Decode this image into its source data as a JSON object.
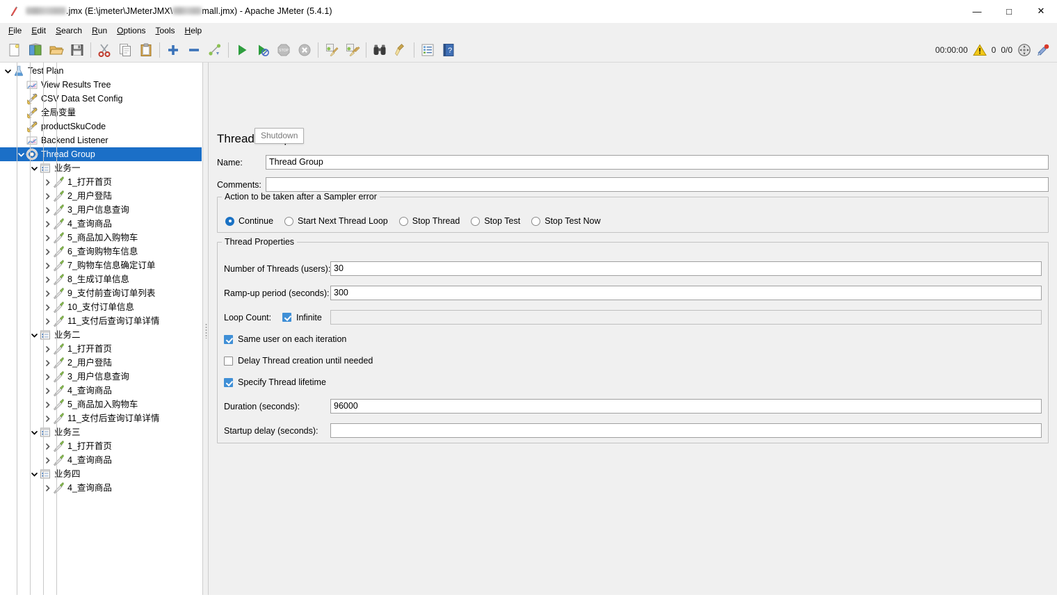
{
  "window": {
    "title_suffix": ".jmx (E:\\jmeter\\JMeterJMX\\",
    "title_mid": "mall.jmx) - Apache JMeter (5.4.1)",
    "app_icon": "jmeter-icon",
    "minimize": "—",
    "maximize": "□",
    "close": "✕"
  },
  "menu": {
    "items": [
      {
        "mnemonic": "F",
        "rest": "ile"
      },
      {
        "mnemonic": "E",
        "rest": "dit"
      },
      {
        "mnemonic": "S",
        "rest": "earch"
      },
      {
        "mnemonic": "R",
        "rest": "un"
      },
      {
        "mnemonic": "O",
        "rest": "ptions"
      },
      {
        "mnemonic": "T",
        "rest": "ools"
      },
      {
        "mnemonic": "H",
        "rest": "elp"
      }
    ]
  },
  "toolbar": {
    "buttons": [
      {
        "name": "new-button",
        "icon": "new-document-icon"
      },
      {
        "name": "templates-button",
        "icon": "templates-icon"
      },
      {
        "name": "open-button",
        "icon": "open-folder-icon"
      },
      {
        "name": "save-button",
        "icon": "save-disk-icon"
      },
      {
        "name": "cut-button",
        "icon": "scissors-icon"
      },
      {
        "name": "copy-button",
        "icon": "copy-icon"
      },
      {
        "name": "paste-button",
        "icon": "clipboard-icon"
      },
      {
        "name": "expand-all-button",
        "icon": "plus-icon"
      },
      {
        "name": "collapse-all-button",
        "icon": "minus-icon"
      },
      {
        "name": "toggle-button",
        "icon": "toggle-icon"
      },
      {
        "name": "start-button",
        "icon": "play-icon"
      },
      {
        "name": "start-no-pauses-button",
        "icon": "play-no-pauses-icon"
      },
      {
        "name": "stop-button",
        "icon": "stop-sign-icon"
      },
      {
        "name": "shutdown-button",
        "icon": "shutdown-icon"
      },
      {
        "name": "clear-button",
        "icon": "clear-broom-icon"
      },
      {
        "name": "clear-all-button",
        "icon": "clear-all-broom-icon"
      },
      {
        "name": "search-button",
        "icon": "binoculars-icon"
      },
      {
        "name": "reset-search-button",
        "icon": "broom-icon"
      },
      {
        "name": "function-helper-button",
        "icon": "function-helper-icon"
      },
      {
        "name": "help-button",
        "icon": "help-book-icon"
      }
    ],
    "timer": "00:00:00",
    "warning_icon": "warning-triangle-icon",
    "error_count": "0",
    "thread_count": "0/0",
    "remote_icon": "remote-engines-icon",
    "shutdown_remote_icon": "remote-shutdown-icon"
  },
  "tooltip": {
    "text": "Shutdown"
  },
  "tree": {
    "nodes": [
      {
        "label": "Test Plan",
        "depth": 0,
        "icon": "test-plan-icon",
        "twist": "down",
        "selected": false
      },
      {
        "label": "View Results Tree",
        "depth": 1,
        "icon": "listener-icon",
        "twist": "none",
        "selected": false
      },
      {
        "label": "CSV Data Set Config",
        "depth": 1,
        "icon": "config-element-icon",
        "twist": "none",
        "selected": false
      },
      {
        "label": "全局变量",
        "depth": 1,
        "icon": "config-element-icon",
        "twist": "none",
        "selected": false
      },
      {
        "label": "productSkuCode",
        "depth": 1,
        "icon": "config-element-icon",
        "twist": "none",
        "selected": false
      },
      {
        "label": "Backend Listener",
        "depth": 1,
        "icon": "listener-icon",
        "twist": "none",
        "selected": false
      },
      {
        "label": "Thread Group",
        "depth": 1,
        "icon": "thread-group-icon",
        "twist": "down",
        "selected": true
      },
      {
        "label": "业务一",
        "depth": 2,
        "icon": "transaction-controller-icon",
        "twist": "down",
        "selected": false
      },
      {
        "label": "1_打开首页",
        "depth": 3,
        "icon": "http-sampler-icon",
        "twist": "right",
        "selected": false
      },
      {
        "label": "2_用户登陆",
        "depth": 3,
        "icon": "http-sampler-icon",
        "twist": "right",
        "selected": false
      },
      {
        "label": "3_用户信息查询",
        "depth": 3,
        "icon": "http-sampler-icon",
        "twist": "right",
        "selected": false
      },
      {
        "label": "4_查询商品",
        "depth": 3,
        "icon": "http-sampler-icon",
        "twist": "right",
        "selected": false
      },
      {
        "label": "5_商品加入购物车",
        "depth": 3,
        "icon": "http-sampler-icon",
        "twist": "right",
        "selected": false
      },
      {
        "label": "6_查询购物车信息",
        "depth": 3,
        "icon": "http-sampler-icon",
        "twist": "right",
        "selected": false
      },
      {
        "label": "7_购物车信息确定订单",
        "depth": 3,
        "icon": "http-sampler-icon",
        "twist": "right",
        "selected": false
      },
      {
        "label": "8_生成订单信息",
        "depth": 3,
        "icon": "http-sampler-icon",
        "twist": "right",
        "selected": false
      },
      {
        "label": "9_支付前查询订单列表",
        "depth": 3,
        "icon": "http-sampler-icon",
        "twist": "right",
        "selected": false
      },
      {
        "label": "10_支付订单信息",
        "depth": 3,
        "icon": "http-sampler-icon",
        "twist": "right",
        "selected": false
      },
      {
        "label": "11_支付后查询订单详情",
        "depth": 3,
        "icon": "http-sampler-icon",
        "twist": "right",
        "selected": false
      },
      {
        "label": "业务二",
        "depth": 2,
        "icon": "transaction-controller-icon",
        "twist": "down",
        "selected": false
      },
      {
        "label": "1_打开首页",
        "depth": 3,
        "icon": "http-sampler-icon",
        "twist": "right",
        "selected": false
      },
      {
        "label": "2_用户登陆",
        "depth": 3,
        "icon": "http-sampler-icon",
        "twist": "right",
        "selected": false
      },
      {
        "label": "3_用户信息查询",
        "depth": 3,
        "icon": "http-sampler-icon",
        "twist": "right",
        "selected": false
      },
      {
        "label": "4_查询商品",
        "depth": 3,
        "icon": "http-sampler-icon",
        "twist": "right",
        "selected": false
      },
      {
        "label": "5_商品加入购物车",
        "depth": 3,
        "icon": "http-sampler-icon",
        "twist": "right",
        "selected": false
      },
      {
        "label": "11_支付后查询订单详情",
        "depth": 3,
        "icon": "http-sampler-icon",
        "twist": "right",
        "selected": false
      },
      {
        "label": "业务三",
        "depth": 2,
        "icon": "transaction-controller-icon",
        "twist": "down",
        "selected": false
      },
      {
        "label": "1_打开首页",
        "depth": 3,
        "icon": "http-sampler-icon",
        "twist": "right",
        "selected": false
      },
      {
        "label": "4_查询商品",
        "depth": 3,
        "icon": "http-sampler-icon",
        "twist": "right",
        "selected": false
      },
      {
        "label": "业务四",
        "depth": 2,
        "icon": "transaction-controller-icon",
        "twist": "down",
        "selected": false
      },
      {
        "label": "4_查询商品",
        "depth": 3,
        "icon": "http-sampler-icon",
        "twist": "right",
        "selected": false
      }
    ]
  },
  "panel": {
    "title": "Thread Group",
    "name_label": "Name:",
    "name_value": "Thread Group",
    "comments_label": "Comments:",
    "comments_value": "",
    "sampler_error_group": "Action to be taken after a Sampler error",
    "sampler_error_options": [
      {
        "label": "Continue",
        "selected": true
      },
      {
        "label": "Start Next Thread Loop",
        "selected": false
      },
      {
        "label": "Stop Thread",
        "selected": false
      },
      {
        "label": "Stop Test",
        "selected": false
      },
      {
        "label": "Stop Test Now",
        "selected": false
      }
    ],
    "thread_properties_group": "Thread Properties",
    "num_threads_label": "Number of Threads (users):",
    "num_threads_value": "30",
    "rampup_label": "Ramp-up period (seconds):",
    "rampup_value": "300",
    "loop_count_label": "Loop Count:",
    "infinite_label": "Infinite",
    "infinite_checked": true,
    "loop_count_value": "",
    "same_user_label": "Same user on each iteration",
    "same_user_checked": true,
    "delay_thread_label": "Delay Thread creation until needed",
    "delay_thread_checked": false,
    "specify_lifetime_label": "Specify Thread lifetime",
    "specify_lifetime_checked": true,
    "duration_label": "Duration (seconds):",
    "duration_value": "96000",
    "startup_delay_label": "Startup delay (seconds):",
    "startup_delay_value": ""
  },
  "colors": {
    "selection_blue": "#1b6fc7",
    "checkbox_blue": "#3f8fd6",
    "radio_blue": "#1b72c4",
    "panel_bg": "#f0f0f0",
    "tree_bg": "#ffffff"
  }
}
